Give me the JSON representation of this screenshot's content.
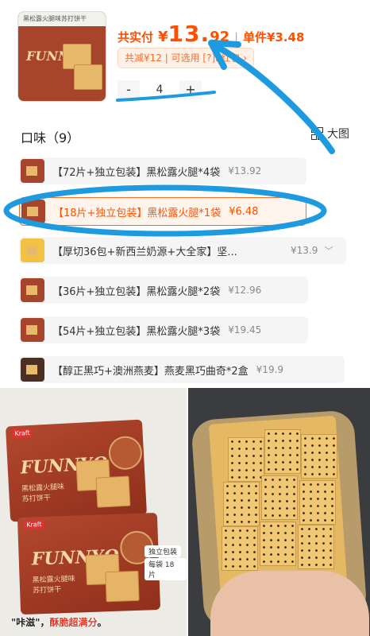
{
  "product": {
    "thumb_title": "黑松露火腿味苏打饼干",
    "brand": "FUNNYQ",
    "price_label": "共实付",
    "currency": "¥",
    "price_int": "13.",
    "price_dec": "92",
    "separator": "|",
    "unit_price": "单件¥3.48",
    "promo": "共减¥12 | 可选用 [?]P红包 ›",
    "quantity": "4",
    "minus": "-",
    "plus": "+"
  },
  "flavor": {
    "heading": "口味（9）",
    "view_toggle": "大图",
    "options": [
      {
        "name": "【72片+独立包装】黑松露火腿*4袋",
        "price": "¥13.92",
        "selected": false
      },
      {
        "name": "【18片+独立包装】黑松露火腿*1袋",
        "price": "¥6.48",
        "selected": true
      },
      {
        "name": "【厚切36包+新西兰奶源+大全家】坚...",
        "price": "¥13.9",
        "selected": false
      },
      {
        "name": "【36片+独立包装】黑松露火腿*2袋",
        "price": "¥12.96",
        "selected": false
      },
      {
        "name": "【54片+独立包装】黑松露火腿*3袋",
        "price": "¥19.45",
        "selected": false
      },
      {
        "name": "【醇正黑巧+澳洲燕麦】燕麦黑巧曲奇*2盒",
        "price": "¥19.9",
        "selected": false
      }
    ]
  },
  "photos": {
    "brand": "FUNNYQ",
    "kraft": "Kraft",
    "pack_flavor": "黑松露火腿味苏打饼干",
    "tag_line1": "独立包装",
    "tag_line2": "每袋 18 片",
    "caption_a": "\"咔滋\"，",
    "caption_b": "酥脆超满分",
    "caption_c": "。"
  },
  "colors": {
    "accent": "#ff5000",
    "annotation": "#1e9be0"
  }
}
